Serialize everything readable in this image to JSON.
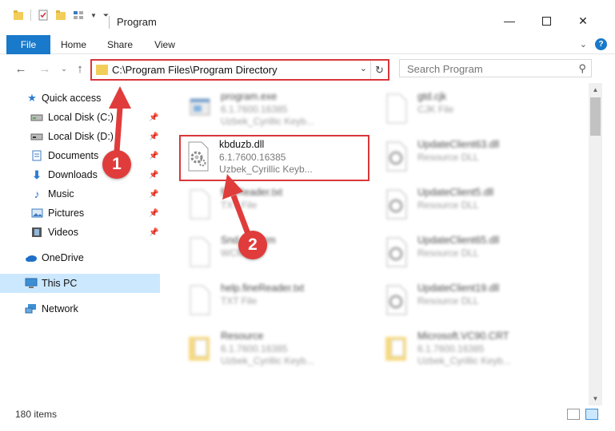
{
  "window": {
    "title": "Program",
    "minimize_icon": "minimize-icon",
    "maximize_icon": "maximize-icon",
    "close_icon": "close-icon"
  },
  "ribbon": {
    "tabs": [
      "File",
      "Home",
      "Share",
      "View"
    ],
    "help_label": "?"
  },
  "address_bar": {
    "path": "C:\\Program Files\\Program Directory",
    "highlight_color": "#d9373a"
  },
  "search": {
    "placeholder": "Search Program"
  },
  "sidebar": {
    "items": [
      {
        "label": "Quick access",
        "icon": "star-icon",
        "pinned": false
      },
      {
        "label": "Local Disk (C:)",
        "icon": "drive-icon",
        "pinned": true
      },
      {
        "label": "Local Disk (D:)",
        "icon": "drive-icon",
        "pinned": true
      },
      {
        "label": "Documents",
        "icon": "documents-icon",
        "pinned": true
      },
      {
        "label": "Downloads",
        "icon": "download-icon",
        "pinned": true
      },
      {
        "label": "Music",
        "icon": "music-icon",
        "pinned": true
      },
      {
        "label": "Pictures",
        "icon": "pictures-icon",
        "pinned": true
      },
      {
        "label": "Videos",
        "icon": "videos-icon",
        "pinned": true
      },
      {
        "label": "OneDrive",
        "icon": "cloud-icon",
        "pinned": false
      },
      {
        "label": "This PC",
        "icon": "computer-icon",
        "pinned": false,
        "selected": true
      },
      {
        "label": "Network",
        "icon": "network-icon",
        "pinned": false
      }
    ]
  },
  "files": [
    {
      "name": "program.exe",
      "line1": "6.1.7600.16385",
      "line2": "Uzbek_Cyrillic Keyb...",
      "icon": "exe-icon"
    },
    {
      "name": "gtd.cjk",
      "line1": "CJK File",
      "line2": "",
      "icon": "blank-file-icon"
    },
    {
      "name": "kbduzb.dll",
      "line1": "6.1.7600.16385",
      "line2": "Uzbek_Cyrillic Keyb...",
      "icon": "dll-gear-icon"
    },
    {
      "name": "UpdateClient63.dll",
      "line1": "Resource DLL",
      "line2": "",
      "icon": "dll-gear-icon"
    },
    {
      "name": "fineReader.txt",
      "line1": "TXT File",
      "line2": "",
      "icon": "text-file-icon"
    },
    {
      "name": "UpdateClient5.dll",
      "line1": "Resource DLL",
      "line2": "",
      "icon": "dll-gear-icon"
    },
    {
      "name": "Snd...4.wcm",
      "line1": "WCM File",
      "line2": "",
      "icon": "blank-file-icon"
    },
    {
      "name": "UpdateClient65.dll",
      "line1": "Resource DLL",
      "line2": "",
      "icon": "dll-gear-icon"
    },
    {
      "name": "help.fineReader.txt",
      "line1": "TXT File",
      "line2": "",
      "icon": "text-file-icon"
    },
    {
      "name": "UpdateClient19.dll",
      "line1": "Resource DLL",
      "line2": "",
      "icon": "dll-gear-icon"
    },
    {
      "name": "Resource",
      "line1": "6.1.7600.16385",
      "line2": "Uzbek_Cyrillic Keyb...",
      "icon": "folder-file-icon"
    },
    {
      "name": "Microsoft.VC90.CRT",
      "line1": "6.1.7600.16385",
      "line2": "Uzbek_Cyrillic Keyb...",
      "icon": "folder-file-icon"
    }
  ],
  "status": {
    "items_count": "180 items"
  },
  "callouts": {
    "step1": "1",
    "step2": "2",
    "color": "#e03c3c"
  }
}
